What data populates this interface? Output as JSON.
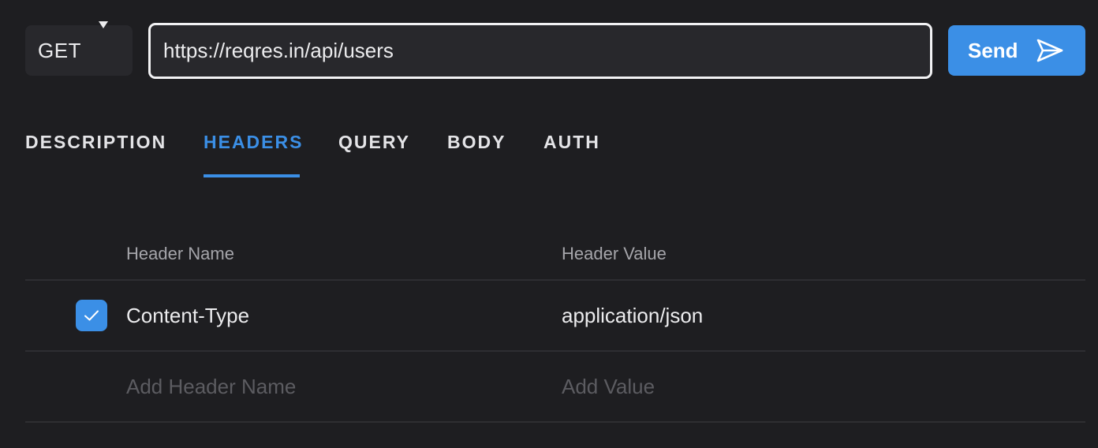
{
  "request": {
    "method": "GET",
    "url": "https://reqres.in/api/users",
    "send_label": "Send"
  },
  "tabs": [
    {
      "label": "DESCRIPTION",
      "active": false
    },
    {
      "label": "HEADERS",
      "active": true
    },
    {
      "label": "QUERY",
      "active": false
    },
    {
      "label": "BODY",
      "active": false
    },
    {
      "label": "AUTH",
      "active": false
    }
  ],
  "headers_table": {
    "columns": [
      "Header Name",
      "Header Value"
    ],
    "rows": [
      {
        "enabled": true,
        "name": "Content-Type",
        "value": "application/json"
      }
    ],
    "new_row": {
      "name_placeholder": "Add Header Name",
      "value_placeholder": "Add Value"
    }
  },
  "colors": {
    "accent": "#3b8fe6",
    "background": "#1e1e21",
    "surface": "#28282c"
  },
  "icons": {
    "method_caret": "caret-down-icon",
    "send": "paper-plane-icon",
    "checkbox": "check-icon"
  }
}
